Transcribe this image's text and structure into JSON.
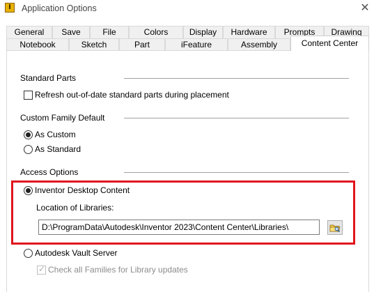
{
  "window": {
    "icon_label": "I",
    "title": "Application Options",
    "close_glyph": "✕"
  },
  "tabs": {
    "row1": [
      "General",
      "Save",
      "File",
      "Colors",
      "Display",
      "Hardware",
      "Prompts",
      "Drawing"
    ],
    "row2": [
      "Notebook",
      "Sketch",
      "Part",
      "iFeature",
      "Assembly",
      "Content Center"
    ],
    "active": "Content Center"
  },
  "standard_parts": {
    "heading": "Standard Parts",
    "refresh_label": "Refresh out-of-date standard parts during placement",
    "refresh_checked": false
  },
  "custom_family_default": {
    "heading": "Custom Family Default",
    "options": [
      "As Custom",
      "As Standard"
    ],
    "selected": "As Custom"
  },
  "access_options": {
    "heading": "Access Options",
    "desktop_label": "Inventor Desktop Content",
    "desktop_selected": true,
    "location_label": "Location of Libraries:",
    "location_value": "D:\\ProgramData\\Autodesk\\Inventor 2023\\Content Center\\Libraries\\",
    "vault_label": "Autodesk Vault Server",
    "vault_selected": false,
    "check_families_label": "Check all Families for Library updates",
    "check_families_checked": true,
    "check_families_enabled": false
  },
  "colors": {
    "highlight_border": "#e0141e",
    "separator": "#a0a0a0"
  },
  "icons": {
    "app": "inventor-app-icon",
    "close": "close-icon",
    "browse": "folder-browse-icon"
  }
}
